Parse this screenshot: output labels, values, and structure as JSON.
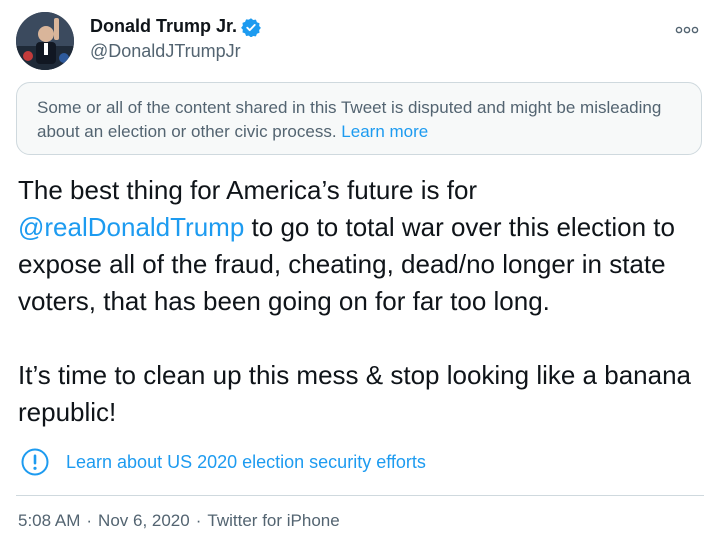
{
  "author": {
    "display_name": "Donald Trump Jr.",
    "handle": "@DonaldJTrumpJr",
    "verified": true,
    "avatar_icon": "profile-photo"
  },
  "notice": {
    "text": "Some or all of the content shared in this Tweet is disputed and might be misleading about an election or other civic process.",
    "link": "Learn more"
  },
  "tweet": {
    "line_1_pre": "The best thing for America’s future is for",
    "mention": "@realDonaldTrump",
    "line_1_post": "to go to total war over this election to expose all of the fraud, cheating, dead/no longer in state voters, that has been going on for far too long.",
    "paragraph_2": "It’s time to clean up this mess & stop looking like a banana republic!"
  },
  "security_link": {
    "text": "Learn about US 2020 election security efforts",
    "icon": "exclamation-circle-icon"
  },
  "meta": {
    "time": "5:08 AM",
    "date": "Nov 6, 2020",
    "source": "Twitter for iPhone",
    "separator": "·"
  },
  "colors": {
    "accent": "#1d9bf0",
    "text": "#0f1419",
    "secondary": "#536471",
    "border": "#cfd9de",
    "notice_bg": "#f7f9f9"
  }
}
